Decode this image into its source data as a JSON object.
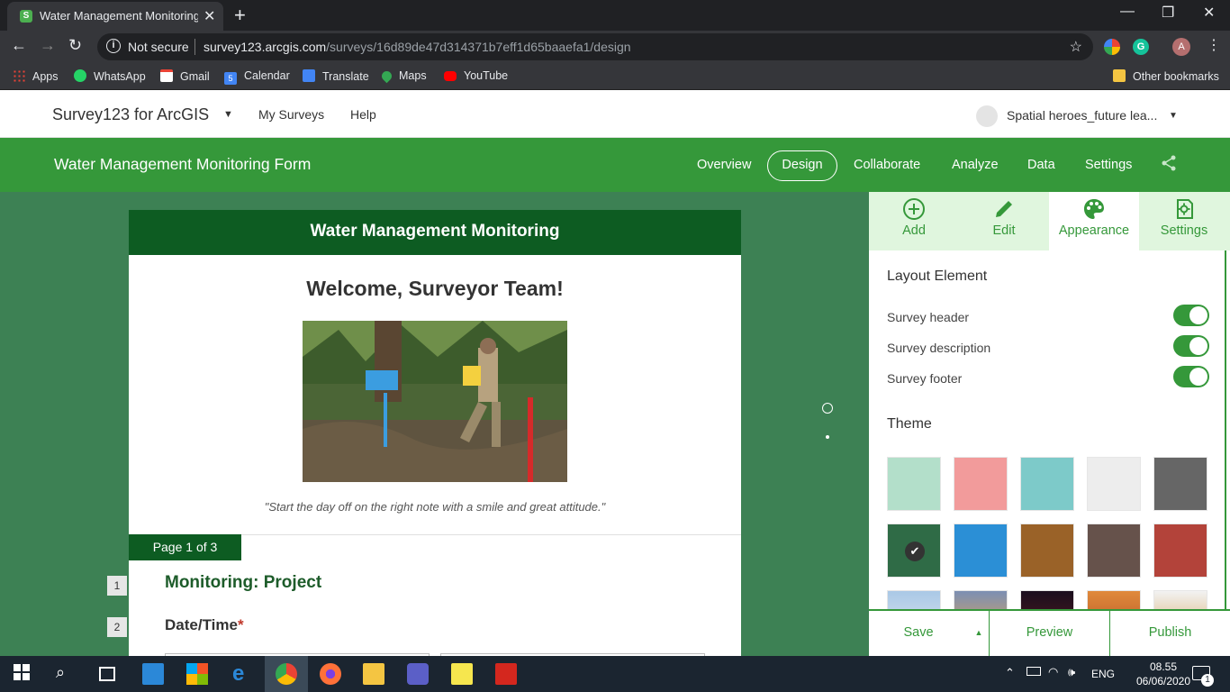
{
  "browser": {
    "tab_title": "Water Management Monitoring F",
    "tab_favicon_letter": "S",
    "url_security": "Not secure",
    "url_domain": "survey123.arcgis.com",
    "url_path": "/surveys/16d89de47d314371b7eff1d65baaefa1/design",
    "profile_initial": "A",
    "bookmarks": [
      {
        "label": "Apps",
        "icon": "apps-grid-icon",
        "color": "#ea4335"
      },
      {
        "label": "WhatsApp",
        "icon": "whatsapp-icon",
        "color": "#25d366"
      },
      {
        "label": "Gmail",
        "icon": "gmail-icon",
        "color": "#ea4335"
      },
      {
        "label": "Calendar",
        "icon": "calendar-icon",
        "color": "#4285f4"
      },
      {
        "label": "Translate",
        "icon": "translate-icon",
        "color": "#4285f4"
      },
      {
        "label": "Maps",
        "icon": "maps-icon",
        "color": "#34a853"
      },
      {
        "label": "YouTube",
        "icon": "youtube-icon",
        "color": "#ff0000"
      }
    ],
    "other_bookmarks": "Other bookmarks",
    "calendar_day": "5"
  },
  "app_header": {
    "brand": "Survey123 for ArcGIS",
    "links": [
      "My Surveys",
      "Help"
    ],
    "user_name": "Spatial heroes_future lea..."
  },
  "nav": {
    "form_title": "Water Management Monitoring Form",
    "items": [
      "Overview",
      "Design",
      "Collaborate",
      "Analyze",
      "Data",
      "Settings"
    ],
    "active": "Design"
  },
  "form": {
    "header": "Water Management Monitoring",
    "welcome": "Welcome, Surveyor Team!",
    "quote": "\"Start the day off on the right note with a smile and great attitude.\"",
    "page_badge": "Page 1 of 3",
    "questions": [
      {
        "number": "1",
        "title": "Monitoring: Project"
      },
      {
        "number": "2",
        "title": "Date/Time",
        "required_mark": "*"
      }
    ]
  },
  "panel": {
    "tabs": [
      {
        "label": "Add",
        "icon": "add-circle-icon"
      },
      {
        "label": "Edit",
        "icon": "pencil-icon"
      },
      {
        "label": "Appearance",
        "icon": "palette-icon"
      },
      {
        "label": "Settings",
        "icon": "document-gear-icon"
      }
    ],
    "active_tab": "Appearance",
    "layout_heading": "Layout Element",
    "toggles": [
      {
        "label": "Survey header",
        "on": true
      },
      {
        "label": "Survey description",
        "on": true
      },
      {
        "label": "Survey footer",
        "on": true
      }
    ],
    "theme_heading": "Theme",
    "theme_swatches": [
      "#b3dfca",
      "#f29b9b",
      "#7dcac9",
      "#ededed",
      "#666666",
      "#2f6b46",
      "#2b8fd6",
      "#9a6228",
      "#66524b",
      "#b3433a"
    ],
    "selected_theme": 5,
    "footer": {
      "save": "Save",
      "preview": "Preview",
      "publish": "Publish"
    }
  },
  "taskbar": {
    "time": "08.55",
    "date": "06/06/2020",
    "lang": "ENG",
    "notif_count": "1"
  },
  "colors": {
    "brand_green": "#35983a",
    "dark_green": "#0d5c22",
    "canvas_green": "#3d8154"
  }
}
